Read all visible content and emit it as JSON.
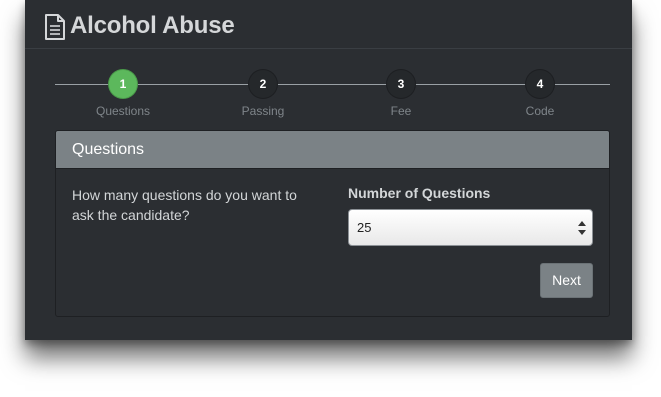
{
  "page": {
    "title": "Alcohol Abuse",
    "title_icon": "document-icon"
  },
  "wizard": {
    "steps": [
      {
        "number": "1",
        "label": "Questions",
        "active": true
      },
      {
        "number": "2",
        "label": "Passing",
        "active": false
      },
      {
        "number": "3",
        "label": "Fee",
        "active": false
      },
      {
        "number": "4",
        "label": "Code",
        "active": false
      }
    ],
    "active_color": "#5cb85c"
  },
  "panel": {
    "heading": "Questions",
    "question": "How many questions do you want to ask the candidate?",
    "field_label": "Number of Questions",
    "select_value": "25",
    "next_label": "Next"
  }
}
